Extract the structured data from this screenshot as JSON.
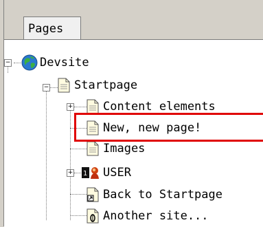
{
  "tab": {
    "label": "Pages"
  },
  "tree": {
    "root": {
      "label": "Devsite"
    },
    "items": [
      {
        "label": "Startpage"
      },
      {
        "label": "Content elements"
      },
      {
        "label": "New, new page!"
      },
      {
        "label": "Images"
      },
      {
        "label": "USER"
      },
      {
        "label": "Back to Startpage"
      },
      {
        "label": "Another site..."
      }
    ]
  },
  "colors": {
    "highlight": "#e00000",
    "panel": "#ffffff",
    "chrome": "#d4d0c8"
  }
}
